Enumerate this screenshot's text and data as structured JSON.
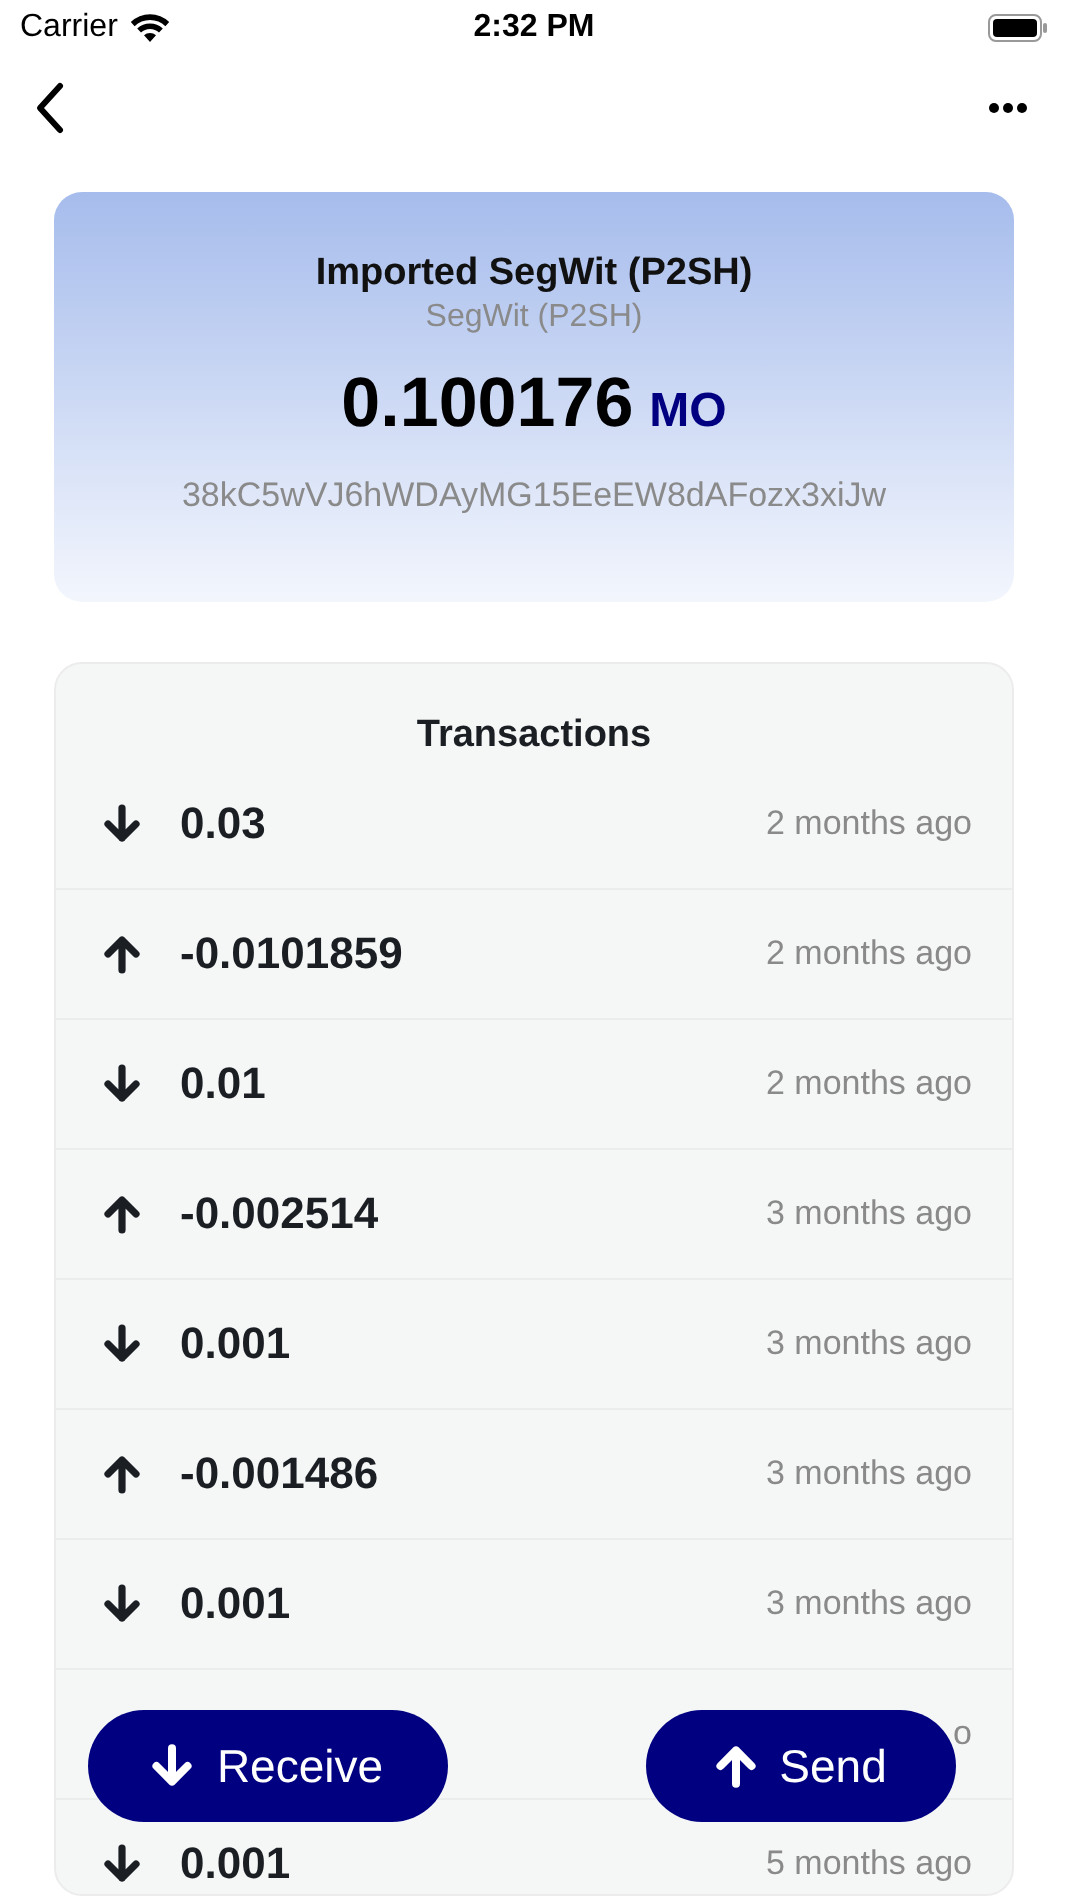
{
  "status_bar": {
    "carrier": "Carrier",
    "time": "2:32 PM"
  },
  "wallet": {
    "name": "Imported SegWit (P2SH)",
    "type": "SegWit (P2SH)",
    "balance": "0.100176",
    "unit": "MO",
    "address": "38kC5wVJ6hWDAyMG15EeEW8dAFozx3xiJw"
  },
  "transactions": {
    "title": "Transactions",
    "rows": [
      {
        "kind": "in",
        "amount": "0.03",
        "time": "2 months ago"
      },
      {
        "kind": "out",
        "amount": "-0.0101859",
        "time": "2 months ago"
      },
      {
        "kind": "in",
        "amount": "0.01",
        "time": "2 months ago"
      },
      {
        "kind": "out",
        "amount": "-0.002514",
        "time": "3 months ago"
      },
      {
        "kind": "in",
        "amount": "0.001",
        "time": "3 months ago"
      },
      {
        "kind": "out",
        "amount": "-0.001486",
        "time": "3 months ago"
      },
      {
        "kind": "in",
        "amount": "0.001",
        "time": "3 months ago"
      },
      {
        "kind": "hidden",
        "time": "o"
      },
      {
        "kind": "in",
        "amount": "0.001",
        "time": "5 months ago"
      }
    ]
  },
  "actions": [
    {
      "kind": "receive",
      "label": "Receive"
    },
    {
      "kind": "send",
      "label": "Send"
    }
  ]
}
